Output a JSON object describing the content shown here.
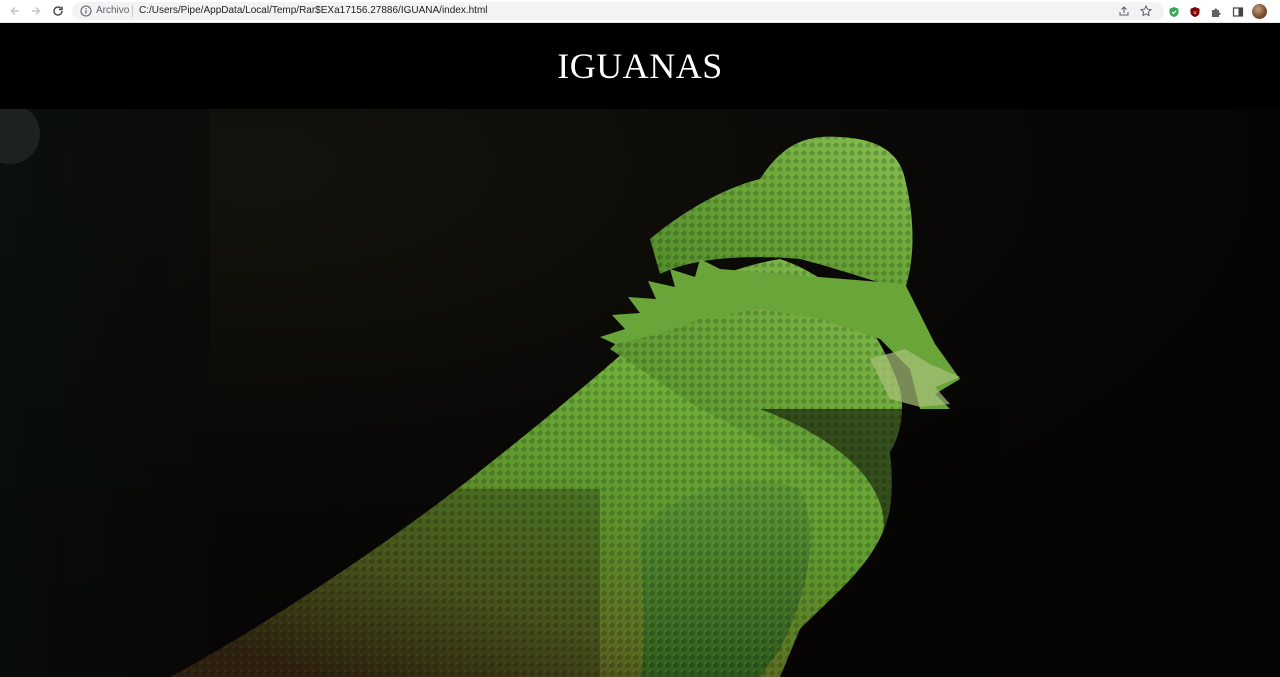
{
  "browser": {
    "scheme_label": "Archivo",
    "url": "C:/Users/Pipe/AppData/Local/Temp/Rar$EXa17156.27886/IGUANA/index.html",
    "icons": {
      "back": "arrow-left-icon",
      "forward": "arrow-right-icon",
      "reload": "reload-icon",
      "site_info": "info-icon",
      "share": "share-icon",
      "bookmark": "star-icon",
      "extension_shield": "shield-icon",
      "extension_ublock": "ublock-icon",
      "extensions": "puzzle-icon",
      "side_panel": "side-panel-icon",
      "profile": "avatar"
    }
  },
  "page": {
    "title": "IGUANAS",
    "hero_image": "bearded-dragon-lizard-photo"
  },
  "colors": {
    "header_bg": "#000000",
    "title_color": "#ffffff",
    "lizard_green": "#5f9a2e",
    "background_dark": "#080706"
  }
}
